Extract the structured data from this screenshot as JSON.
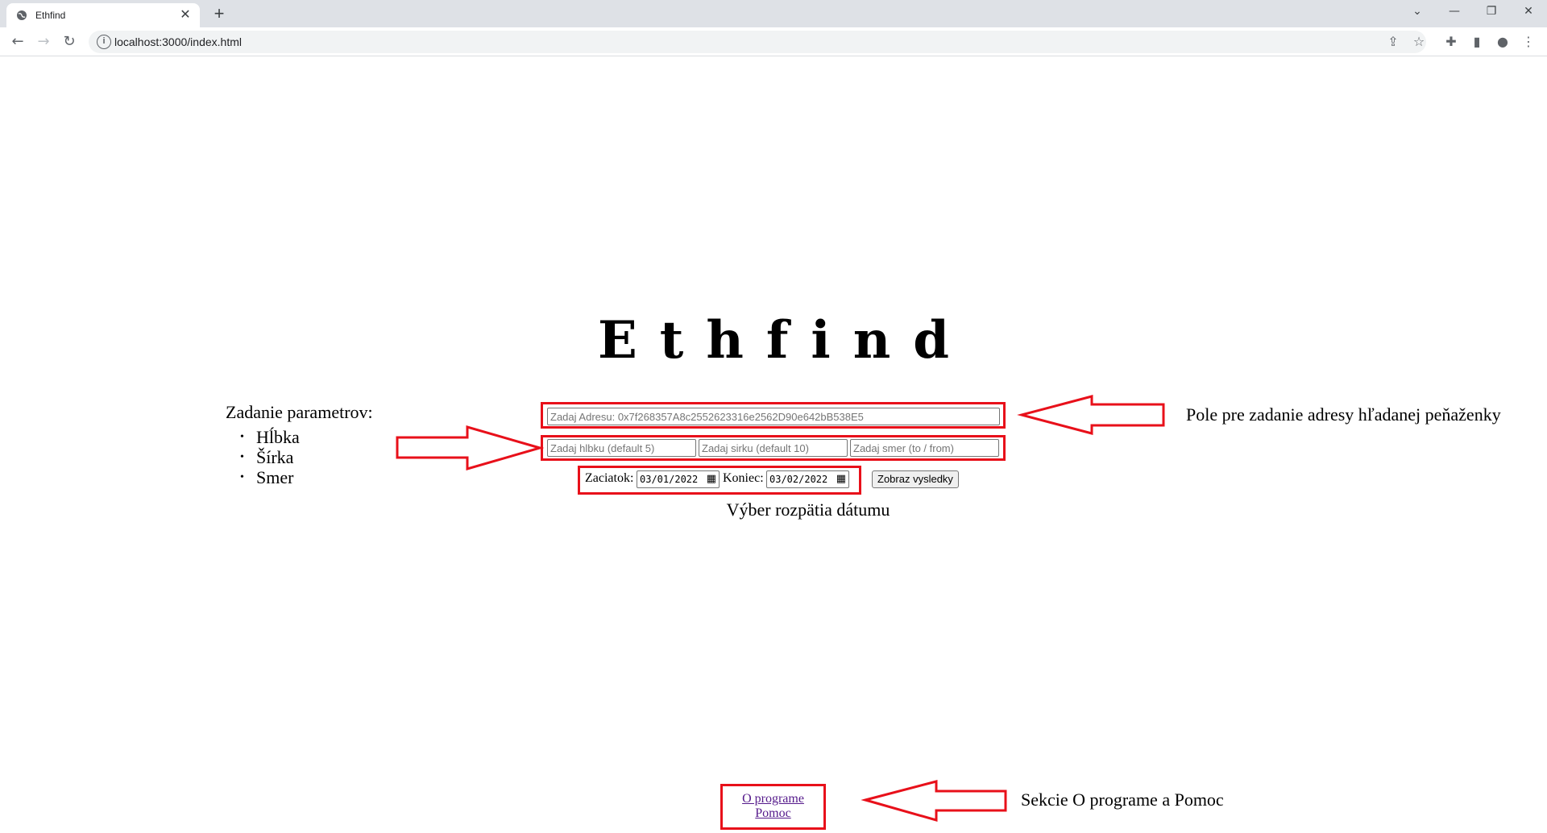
{
  "browser": {
    "tab_title": "Ethfind",
    "url": "localhost:3000/index.html"
  },
  "page": {
    "title": "Ethfind",
    "address_placeholder": "Zadaj Adresu: 0x7f268357A8c2552623316e2562D90e642bB538E5",
    "depth_placeholder": "Zadaj hlbku (default 5)",
    "width_placeholder": "Zadaj sirku (default 10)",
    "direction_placeholder": "Zadaj smer (to / from)",
    "start_label": "Zaciatok:",
    "start_value": "03/01/2022",
    "end_label": "Koniec:",
    "end_value": "03/02/2022",
    "submit_label": "Zobraz vysledky",
    "about_link": "O programe",
    "help_link": "Pomoc"
  },
  "annotations": {
    "params_heading": "Zadanie parametrov:",
    "params_items": [
      "Hĺbka",
      "Šírka",
      "Smer"
    ],
    "address_note": "Pole pre zadanie adresy hľadanej peňaženky",
    "date_note": "Výber rozpätia dátumu",
    "sections_note": "Sekcie O programe a Pomoc"
  },
  "colors": {
    "annotation_red": "#e8101a",
    "visited_link": "#551a8b"
  }
}
